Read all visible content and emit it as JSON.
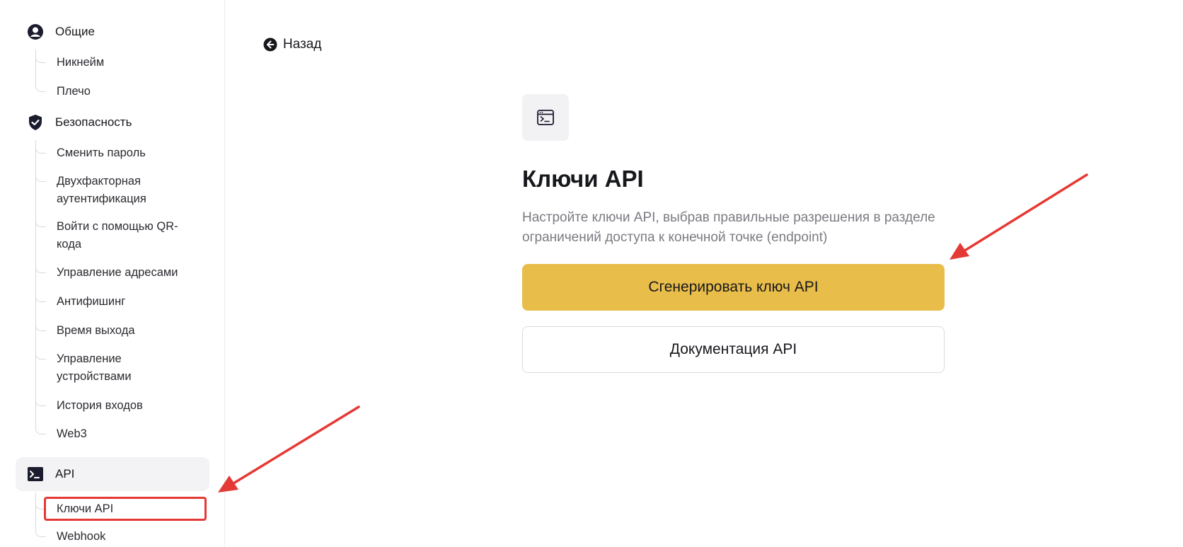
{
  "sidebar": {
    "general": {
      "label": "Общие",
      "icon": "user-circle-icon",
      "items": [
        "Никнейм",
        "Плечо"
      ]
    },
    "security": {
      "label": "Безопасность",
      "icon": "shield-check-icon",
      "items": [
        "Сменить пароль",
        "Двухфакторная\nаутентификация",
        "Войти с помощью QR-\nкода",
        "Управление адресами",
        "Антифишинг",
        "Время выхода",
        "Управление\nустройствами",
        "История входов",
        "Web3"
      ]
    },
    "api": {
      "label": "API",
      "icon": "terminal-icon",
      "items": [
        "Ключи API",
        "Webhook"
      ],
      "active_item": "Ключи API"
    }
  },
  "main": {
    "back_label": "Назад",
    "icon": "terminal-window-icon",
    "title": "Ключи API",
    "description": "Настройте ключи API, выбрав правильные разрешения в разделе ограничений доступа к конечной точке (endpoint)",
    "primary_button": "Сгенерировать ключ API",
    "secondary_button": "Документация API"
  },
  "colors": {
    "accent": "#e9bd4a",
    "annotation": "#e53935",
    "active_bg": "#f3f3f5"
  }
}
